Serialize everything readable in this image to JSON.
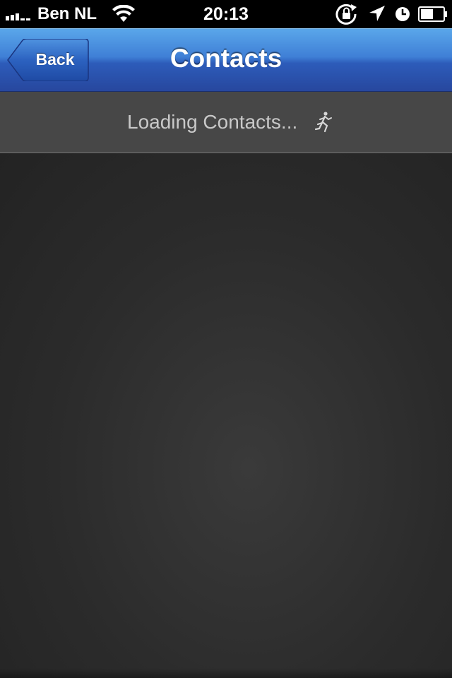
{
  "status_bar": {
    "carrier": "Ben NL",
    "time": "20:13",
    "icons": [
      "signal-icon",
      "wifi-icon",
      "rotation-lock-icon",
      "location-icon",
      "alarm-icon",
      "battery-icon"
    ]
  },
  "nav": {
    "back_label": "Back",
    "title": "Contacts"
  },
  "loading": {
    "text": "Loading Contacts...",
    "icon": "runner-icon"
  },
  "colors": {
    "nav_top": "#5aa7ea",
    "nav_bottom": "#27479e",
    "content_bg": "#2b2b2b",
    "loading_bg": "#474747",
    "loading_text": "#c9c9c9"
  }
}
